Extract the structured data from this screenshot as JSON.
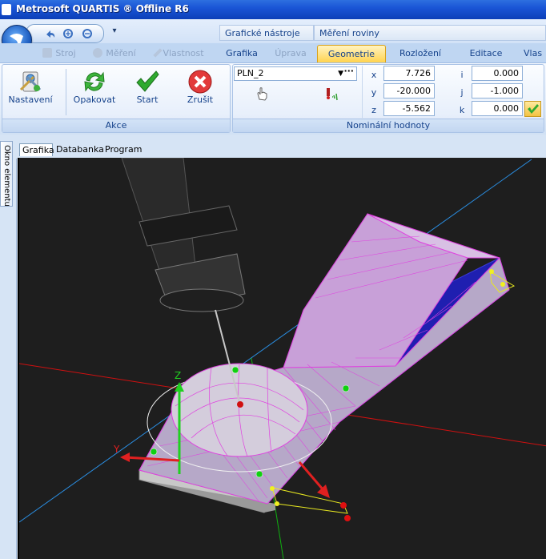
{
  "window": {
    "title": "Metrosoft QUARTIS ® Offline R6"
  },
  "context_tabs": [
    "Grafické nástroje",
    "Měření roviny"
  ],
  "ribbon_tabs": [
    {
      "label": "Stroj",
      "state": "disabled"
    },
    {
      "label": "Měření",
      "state": "disabled"
    },
    {
      "label": "Vlastnost",
      "state": "disabled"
    },
    {
      "label": "Grafika",
      "state": "normal"
    },
    {
      "label": "Úprava",
      "state": "disabled"
    },
    {
      "label": "Geometrie",
      "state": "active"
    },
    {
      "label": "Rozložení",
      "state": "normal"
    },
    {
      "label": "Editace",
      "state": "normal"
    },
    {
      "label": "Vlas",
      "state": "normal"
    }
  ],
  "akce": {
    "group_label": "Akce",
    "buttons": [
      {
        "label": "Nastavení",
        "icon": "settings-tools-icon"
      },
      {
        "label": "Opakovat",
        "icon": "repeat-arrows-icon"
      },
      {
        "label": "Start",
        "icon": "checkmark-icon"
      },
      {
        "label": "Zrušit",
        "icon": "cancel-x-icon"
      }
    ]
  },
  "nominal": {
    "group_label": "Nominální hodnoty",
    "element_select": "PLN_2",
    "coords": [
      {
        "axis": "x",
        "value": "7.726",
        "dir_axis": "i",
        "dir_value": "0.000"
      },
      {
        "axis": "y",
        "value": "-20.000",
        "dir_axis": "j",
        "dir_value": "-1.000"
      },
      {
        "axis": "z",
        "value": "-5.562",
        "dir_axis": "k",
        "dir_value": "0.000"
      }
    ]
  },
  "left_panel_tab": "Okno elementu",
  "doc_tabs": [
    "Grafika",
    "Databanka",
    "Program"
  ],
  "viewport": {
    "axis_labels": {
      "z": "Z",
      "y": "Y"
    },
    "colors": {
      "background": "#1e1e1e",
      "mesh": "#e040e0",
      "part_side": "#1a1aa0",
      "red_axis": "#e01010",
      "blue_axis": "#2a8de0",
      "green_axis": "#10c010"
    }
  }
}
